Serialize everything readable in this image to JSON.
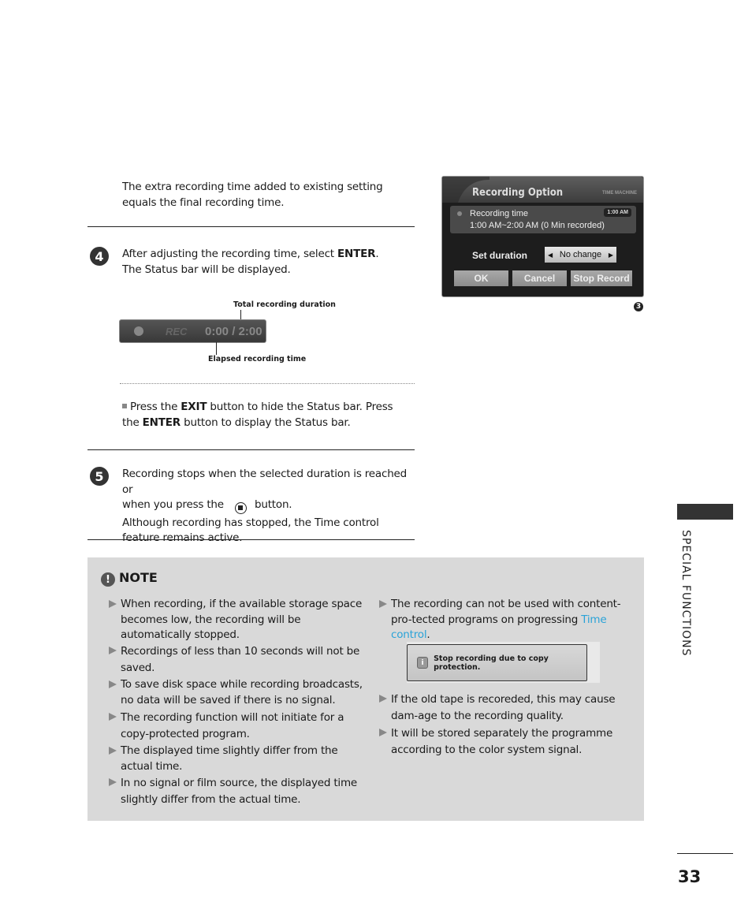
{
  "intro_text": "The extra recording time added to existing setting equals the final recording time.",
  "step4": {
    "number": "4",
    "text_before": "After adjusting the recording time, select ",
    "key": "ENTER",
    "text_after": ". The Status bar will be displayed."
  },
  "status_bar": {
    "rec_label": "REC",
    "time": "0:00 / 2:00",
    "callout_total": "Total recording duration",
    "callout_elapsed": "Elapsed recording time"
  },
  "tip": {
    "t1": "Press the ",
    "key1": "EXIT",
    "t2": " button to hide the Status bar. Press the ",
    "key2": "ENTER",
    "t3": " button to display the Status bar."
  },
  "step5": {
    "number": "5",
    "line1": "Recording stops when the selected duration is reached or",
    "line2_before": "when you press the",
    "line2_after": "button.",
    "line3": "Although recording has stopped, the Time control feature remains active."
  },
  "dialog": {
    "title": "Recording Option",
    "tag": "TIME MACHINE",
    "recording_time_label": "Recording time",
    "recording_time_value": "1:00 AM~2:00 AM (0  Min recorded)",
    "clock_badge": "1:00 AM",
    "set_duration_label": "Set duration",
    "set_duration_value": "No change",
    "buttons": [
      "OK",
      "Cancel",
      "Stop Record"
    ],
    "figure_number": "3"
  },
  "note": {
    "title": "NOTE",
    "left_items": [
      "When recording, if the available storage space becomes low, the recording will be automatically stopped.",
      "Recordings of less than 10 seconds will not be saved.",
      "To save disk space while recording broadcasts, no data will be saved if there is no signal.",
      "The recording function will not initiate for a copy-protected program.",
      "The displayed time slightly differ from the actual time.",
      "In no signal or film source, the displayed time slightly differ from the actual time."
    ],
    "right_item1_before": "The recording can not be used with content-pro-tected programs on progressing ",
    "right_item1_link": "Time control",
    "right_item1_after": ".",
    "copy_message": "Stop recording due to copy protection.",
    "right_items": [
      "If the old tape is recoreded, this may cause dam-age to the recording quality.",
      " It will be stored separately the programme according to the color system signal."
    ],
    "link_color": "#2aa3d8"
  },
  "sidebar": {
    "section": "SPECIAL FUNCTIONS"
  },
  "page_number": "33"
}
